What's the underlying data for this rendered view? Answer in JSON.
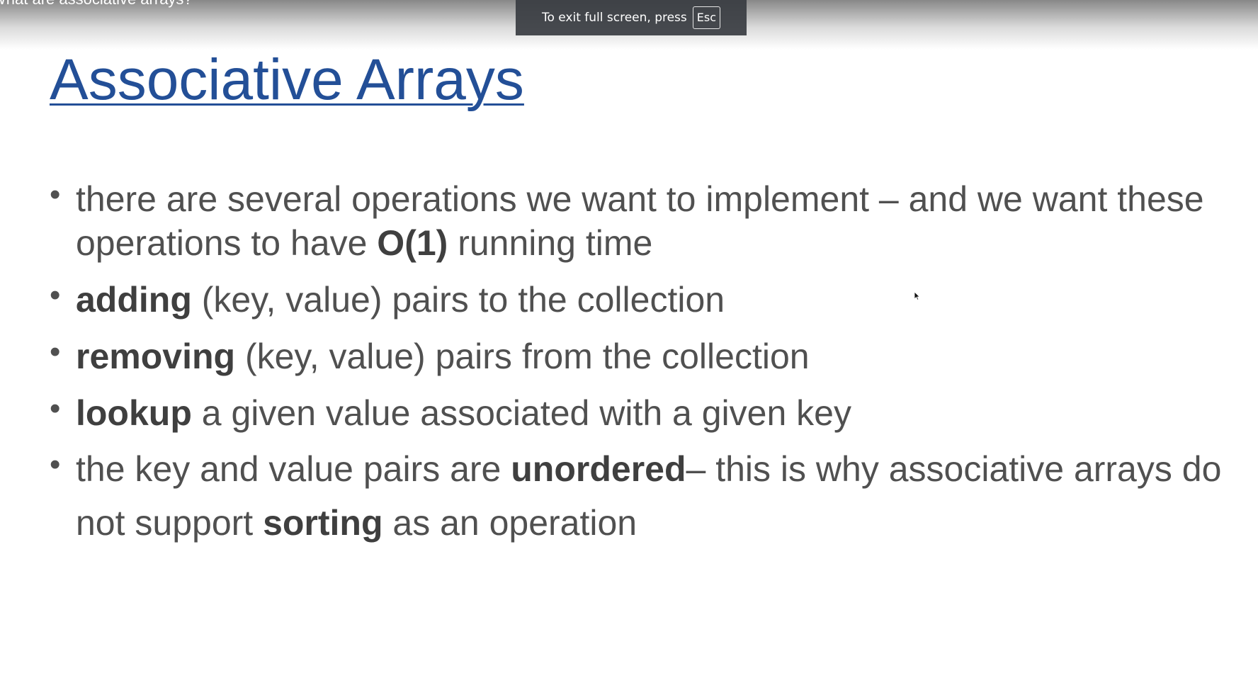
{
  "browser_overlay": {
    "video_title": "What are associative arrays?",
    "fullscreen_notice": "To exit full screen, press",
    "fullscreen_key": "Esc"
  },
  "slide": {
    "title": "Associative Arrays",
    "bullets": [
      {
        "seg1": "there are several operations we want to implement – and we want these operations to have ",
        "bold1": "O(1)",
        "seg2": " running time"
      },
      {
        "bold1": "adding",
        "seg1": " (key, value) pairs to the collection"
      },
      {
        "bold1": "removing",
        "seg1": " (key, value) pairs from the collection"
      },
      {
        "bold1": "lookup",
        "seg1": " a given value associated with a given key"
      },
      {
        "seg1": "the key and value pairs are ",
        "bold1": "unordered",
        "seg2": "– this is why associative arrays do not support ",
        "bold2": "sorting",
        "seg3": " as an operation"
      }
    ]
  },
  "icons": {
    "mouse_cursor": "mouse-pointer-icon"
  },
  "colors": {
    "title": "#234f97",
    "body_text": "#505050",
    "toast_bg": "#383c41"
  }
}
